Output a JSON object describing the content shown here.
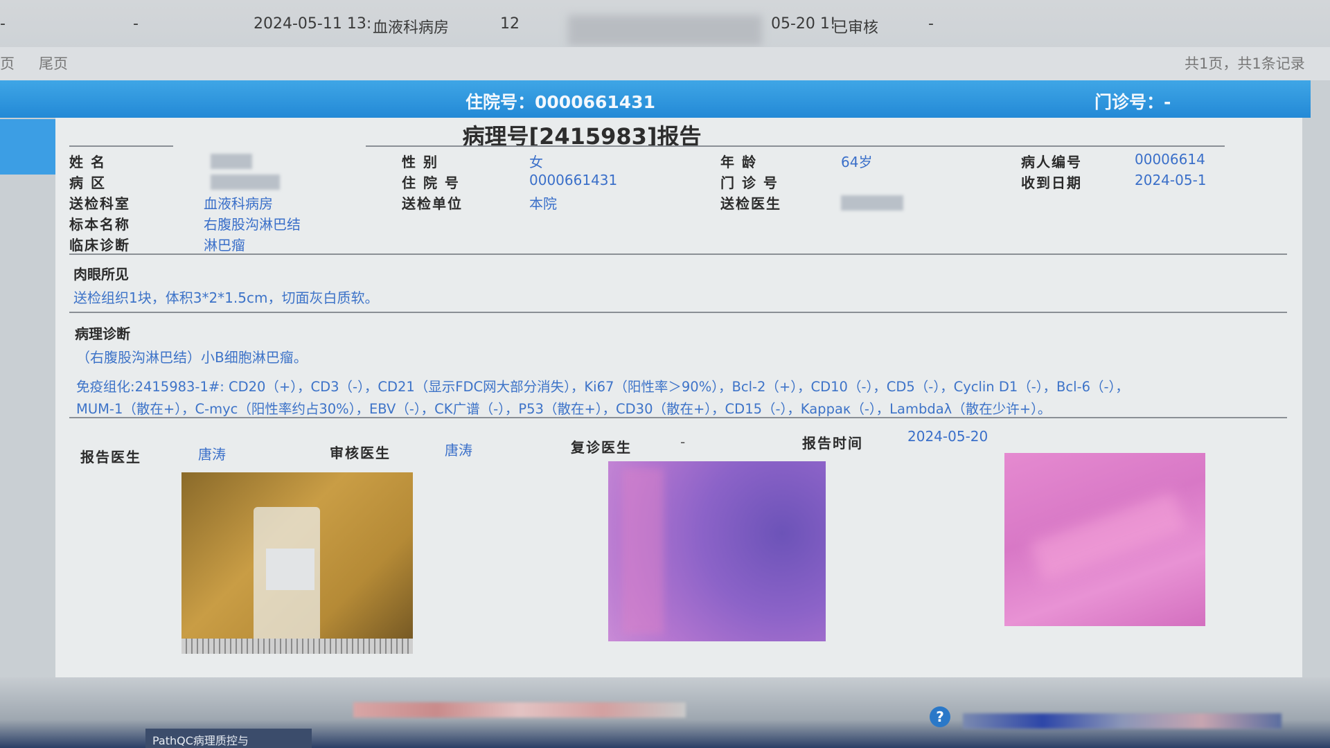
{
  "list_row": {
    "date": "2024-05-11 13:",
    "dept": "血液科病房",
    "count": "12",
    "dash1": "-",
    "dash2": "-",
    "report_date": "05-20 1!",
    "status": "已审核",
    "dash3": "-"
  },
  "pager": {
    "first_label": "页",
    "last_label": "尾页",
    "summary": "共1页，共1条记录"
  },
  "header": {
    "inpatient_label": "住院号：",
    "inpatient_no": "0000661431",
    "outpatient_label": "门诊号：",
    "outpatient_no": "-"
  },
  "report": {
    "title": "病理号[2415983]报告",
    "fields": {
      "name_label": "姓 名",
      "ward_label": "病 区",
      "dept_label": "送检科室",
      "dept_value": "血液科病房",
      "specimen_label": "标本名称",
      "specimen_value": "右腹股沟淋巴结",
      "diag_label": "临床诊断",
      "diag_value": "淋巴瘤",
      "sex_label": "性 别",
      "sex_value": "女",
      "inpatient_label": "住 院 号",
      "inpatient_value": "0000661431",
      "unit_label": "送检单位",
      "unit_value": "本院",
      "age_label": "年 龄",
      "age_value": "64岁",
      "outpatient_label": "门 诊 号",
      "doctor_send_label": "送检医生",
      "patient_no_label": "病人编号",
      "patient_no_value": "00006614",
      "received_label": "收到日期",
      "received_value": "2024-05-1"
    },
    "gross_title": "肉眼所见",
    "gross_text": "送检组织1块，体积3*2*1.5cm，切面灰白质软。",
    "path_title": "病理诊断",
    "path_text": "（右腹股沟淋巴结）小B细胞淋巴瘤。",
    "ihc_line1": "免疫组化:2415983-1#:  CD20（+），CD3（-），CD21（显示FDC网大部分消失），Ki67（阳性率＞90%），Bcl-2（+），CD10（-），CD5（-），Cyclin D1（-），Bcl-6（-），",
    "ihc_line2": "MUM-1（散在+），C-myc（阳性率约占30%），EBV（-），CK广谱（-），P53（散在+），CD30（散在+），CD15（-），Kappaκ（-），Lambdaλ（散在少许+）。",
    "sign": {
      "report_doc_label": "报告医生",
      "report_doc_value": "唐涛",
      "audit_doc_label": "审核医生",
      "audit_doc_value": "唐涛",
      "review_doc_label": "复诊医生",
      "review_doc_value": "-",
      "report_time_label": "报告时间",
      "report_time_value": "2024-05-20"
    }
  },
  "taskbar": {
    "app_label": "PathQC病理质控与"
  }
}
